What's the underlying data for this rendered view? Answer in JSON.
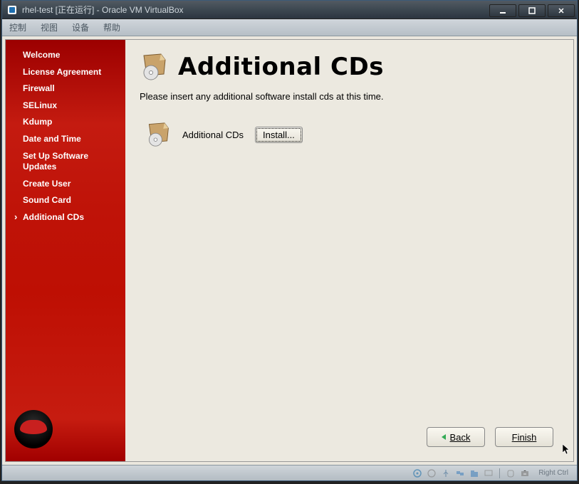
{
  "window": {
    "title": "rhel-test [正在运行] - Oracle VM VirtualBox",
    "min_icon": "minimize",
    "max_icon": "maximize",
    "close_icon": "close"
  },
  "menu": {
    "items": [
      "控制",
      "视图",
      "设备",
      "帮助"
    ]
  },
  "sidebar": {
    "items": [
      {
        "label": "Welcome",
        "active": false
      },
      {
        "label": "License Agreement",
        "active": false
      },
      {
        "label": "Firewall",
        "active": false
      },
      {
        "label": "SELinux",
        "active": false
      },
      {
        "label": "Kdump",
        "active": false
      },
      {
        "label": "Date and Time",
        "active": false
      },
      {
        "label": "Set Up Software Updates",
        "active": false
      },
      {
        "label": "Create User",
        "active": false
      },
      {
        "label": "Sound Card",
        "active": false
      },
      {
        "label": "Additional CDs",
        "active": true
      }
    ]
  },
  "header": {
    "title": "Additional CDs"
  },
  "content": {
    "description": "Please insert any additional software install cds at this time.",
    "row_label": "Additional CDs",
    "install_button": "Install..."
  },
  "nav": {
    "back": "Back",
    "finish": "Finish"
  },
  "status": {
    "text": "Right Ctrl"
  }
}
